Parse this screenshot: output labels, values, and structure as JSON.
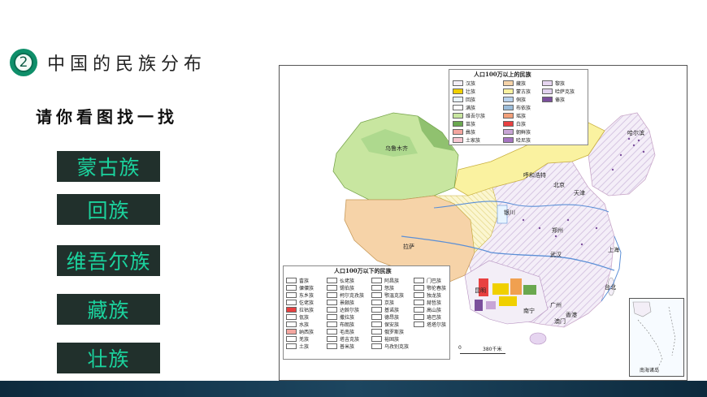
{
  "header": {
    "badge_number": "2",
    "title": "中国的民族分布"
  },
  "subtitle": "请你看图找一找",
  "buttons": [
    {
      "label": "蒙古族"
    },
    {
      "label": "回族"
    },
    {
      "label": "维吾尔族"
    },
    {
      "label": "藏族"
    },
    {
      "label": "壮族"
    }
  ],
  "map": {
    "legend_large": {
      "title": "人口100万以上的民族",
      "items": [
        {
          "label": "汉族",
          "color": "#f3eef7"
        },
        {
          "label": "壮族",
          "color": "#f0d000"
        },
        {
          "label": "回族",
          "color": "#e8f4ff"
        },
        {
          "label": "满族",
          "color": "#ffffff"
        },
        {
          "label": "维吾尔族",
          "color": "#c8e6a0"
        },
        {
          "label": "苗族",
          "color": "#6aa84f"
        },
        {
          "label": "彝族",
          "color": "#f4a6a0"
        },
        {
          "label": "土家族",
          "color": "#f7c6d0"
        },
        {
          "label": "藏族",
          "color": "#f6d3a8"
        },
        {
          "label": "蒙古族",
          "color": "#faf2a0"
        },
        {
          "label": "侗族",
          "color": "#b9d3ee"
        },
        {
          "label": "布依族",
          "color": "#9bbcd9"
        },
        {
          "label": "瑶族",
          "color": "#f2a07a"
        },
        {
          "label": "白族",
          "color": "#e84040"
        },
        {
          "label": "朝鲜族",
          "color": "#c8a6d6"
        },
        {
          "label": "哈尼族",
          "color": "#a675c2"
        },
        {
          "label": "黎族",
          "color": "#e6d5f0"
        },
        {
          "label": "哈萨克族",
          "color": "#e2d2ef"
        },
        {
          "label": "傣族",
          "color": "#7b4f9c"
        }
      ]
    },
    "legend_small": {
      "title": "人口100万以下的民族",
      "columns": [
        [
          "畲族",
          "傈僳族",
          "东乡族",
          "仡佬族",
          "拉祜族",
          "佤族",
          "水族",
          "纳西族",
          "羌族",
          "土族"
        ],
        [
          "仫佬族",
          "锡伯族",
          "柯尔克孜族",
          "景颇族",
          "达斡尔族",
          "撒拉族",
          "布朗族",
          "毛南族",
          "塔吉克族",
          "普米族"
        ],
        [
          "阿昌族",
          "怒族",
          "鄂温克族",
          "京族",
          "基诺族",
          "德昂族",
          "保安族",
          "俄罗斯族",
          "裕固族",
          "乌孜别克族"
        ],
        [
          "门巴族",
          "鄂伦春族",
          "独龙族",
          "赫哲族",
          "高山族",
          "珞巴族",
          "塔塔尔族"
        ]
      ]
    },
    "cities": [
      {
        "name": "乌鲁木齐"
      },
      {
        "name": "呼和浩特"
      },
      {
        "name": "北京"
      },
      {
        "name": "天津"
      },
      {
        "name": "哈尔滨"
      },
      {
        "name": "银川"
      },
      {
        "name": "郑州"
      },
      {
        "name": "拉萨"
      },
      {
        "name": "武汉"
      },
      {
        "name": "上海"
      },
      {
        "name": "昆明"
      },
      {
        "name": "南宁"
      },
      {
        "name": "广州"
      },
      {
        "name": "香港"
      },
      {
        "name": "澳门"
      },
      {
        "name": "台北"
      }
    ],
    "scale": {
      "zero": "0",
      "distance": "380千米"
    },
    "inset_label": "南海诸岛"
  },
  "colors": {
    "accent_green": "#0f8f6a",
    "button_bg": "#21302c",
    "button_text": "#1bd29d",
    "footer": "#12344a"
  }
}
